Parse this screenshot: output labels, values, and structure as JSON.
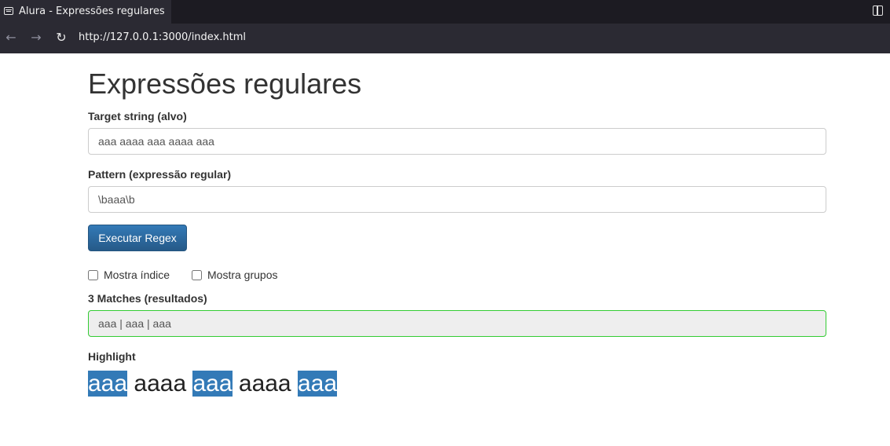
{
  "browser": {
    "tab_title": "Alura - Expressões regulares",
    "url": "http://127.0.0.1:3000/index.html",
    "back_glyph": "←",
    "forward_glyph": "→",
    "reload_glyph": "↻"
  },
  "page": {
    "title": "Expressões regulares",
    "target_label": "Target string (alvo)",
    "target_value": "aaa aaaa aaa aaaa aaa",
    "pattern_label": "Pattern (expressão regular)",
    "pattern_value": "\\baaa\\b",
    "execute_button": "Executar Regex",
    "show_index_label": "Mostra índice",
    "show_groups_label": "Mostra grupos",
    "matches_label": "3 Matches (resultados)",
    "matches_value": "aaa | aaa | aaa",
    "highlight_label": "Highlight",
    "highlight_segments": [
      {
        "text": "aaa",
        "match": true
      },
      {
        "text": " aaaa ",
        "match": false
      },
      {
        "text": "aaa",
        "match": true
      },
      {
        "text": " aaaa ",
        "match": false
      },
      {
        "text": "aaa",
        "match": true
      }
    ]
  },
  "colors": {
    "match_highlight": "#337ab7",
    "result_border": "#33cc33",
    "button": "#337ab7"
  }
}
